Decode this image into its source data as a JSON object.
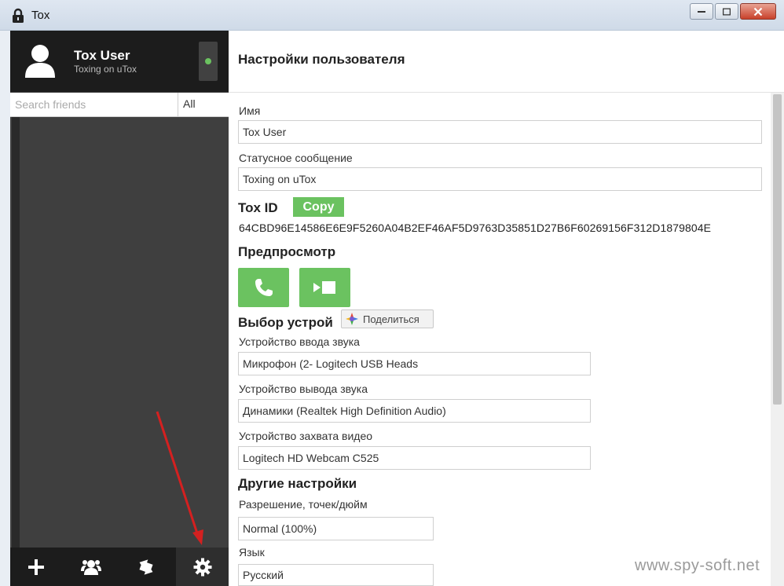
{
  "window": {
    "title": "Tox"
  },
  "user": {
    "name": "Tox User",
    "status_message": "Toxing on uTox",
    "status_color": "#6bc260"
  },
  "search": {
    "placeholder": "Search friends",
    "filter": "All"
  },
  "bottom_bar": {
    "icons": [
      "plus-icon",
      "group-icon",
      "transfer-icon",
      "gear-icon"
    ]
  },
  "settings": {
    "title": "Настройки пользователя",
    "name_label": "Имя",
    "name_value": "Tox User",
    "status_label": "Статусное сообщение",
    "status_value": "Toxing on uTox",
    "toxid_label": "Tox ID",
    "copy_label": "Copy",
    "toxid_value": "64CBD96E14586E6E9F5260A04B2EF46AF5D9763D35851D27B6F60269156F312D1879804E",
    "preview_label": "Предпросмотр",
    "devices_label": "Выбор устрой",
    "audio_in_label": "Устройство ввода звука",
    "audio_in_value": "Микрофон (2- Logitech USB Heads",
    "audio_out_label": "Устройство вывода звука",
    "audio_out_value": "Динамики (Realtek High Definition Audio)",
    "video_label": "Устройство захвата видео",
    "video_value": "Logitech HD Webcam C525",
    "other_label": "Другие настройки",
    "dpi_label": "Разрешение, точек/дюйм",
    "dpi_value": "Normal (100%)",
    "lang_label": "Язык",
    "lang_value": "Русский"
  },
  "share_popup": {
    "label": "Поделиться"
  },
  "watermark": "www.spy-soft.net",
  "colors": {
    "accent": "#6bc260",
    "sidebar": "#404040",
    "header": "#1c1c1c",
    "arrow": "#d42020"
  }
}
